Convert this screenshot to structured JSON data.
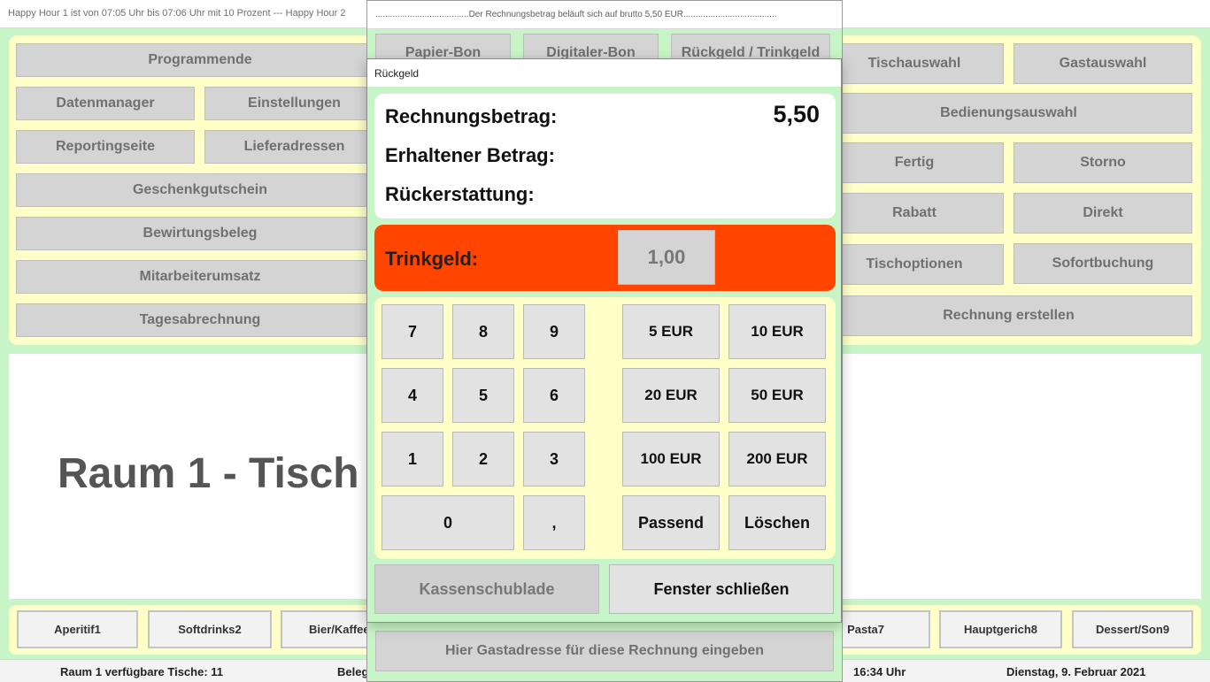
{
  "ticker": "Happy Hour 1 ist von 07:05 Uhr bis 07:06 Uhr mit 10 Prozent --- Happy Hour 2",
  "left_menu": {
    "programmende": "Programmende",
    "datenmanager": "Datenmanager",
    "einstellungen": "Einstellungen",
    "reportingseite": "Reportingseite",
    "lieferadressen": "Lieferadressen",
    "geschenkgutschein": "Geschenkgutschein",
    "bewirtungsbeleg": "Bewirtungsbeleg",
    "mitarbeiterumsatz": "Mitarbeiterumsatz",
    "tagesabrechnung": "Tagesabrechnung"
  },
  "right_menu": {
    "tischauswahl": "Tischauswahl",
    "gastauswahl": "Gastauswahl",
    "bedienungsauswahl": "Bedienungsauswahl",
    "fertig": "Fertig",
    "storno": "Storno",
    "rabatt": "Rabatt",
    "direkt": "Direkt",
    "tischoptionen": "Tischoptionen",
    "sofortbuchung": "Sofortbuchung",
    "rechnung_erstellen": "Rechnung erstellen"
  },
  "room_title": "Raum 1 - Tisch",
  "categories": [
    "Aperitif1",
    "Softdrinks2",
    "Bier/Kaffee",
    "Pasta7",
    "Hauptgerich8",
    "Dessert/Son9"
  ],
  "status": {
    "tables": "Raum 1 verfügbare Tische: 11",
    "beleg": "Beleg",
    "time": "16:34 Uhr",
    "date": "Dienstag, 9. Februar 2021"
  },
  "rechnung": {
    "title": "......................................Der Rechnungsbetrag beläuft sich auf brutto 5,50 EUR......................................",
    "papier_bon": "Papier-Bon",
    "digitaler_bon": "Digitaler-Bon",
    "rueckgeld_trinkgeld": "Rückgeld / Trinkgeld",
    "gastadresse": "Hier Gastadresse für diese Rechnung eingeben"
  },
  "dialog": {
    "title": "Rückgeld",
    "rechnungsbetrag_label": "Rechnungsbetrag:",
    "rechnungsbetrag_value": "5,50",
    "erhalten_label": "Erhaltener Betrag:",
    "rueckerstattung_label": "Rückerstattung:",
    "trinkgeld_label": "Trinkgeld:",
    "trinkgeld_value": "1,00",
    "keys": {
      "k7": "7",
      "k8": "8",
      "k9": "9",
      "k4": "4",
      "k5": "5",
      "k6": "6",
      "k1": "1",
      "k2": "2",
      "k3": "3",
      "k0": "0",
      "comma": ","
    },
    "amounts": {
      "eur5": "5 EUR",
      "eur10": "10 EUR",
      "eur20": "20 EUR",
      "eur50": "50 EUR",
      "eur100": "100 EUR",
      "eur200": "200 EUR"
    },
    "passend": "Passend",
    "loeschen": "Löschen",
    "kassenschublade": "Kassenschublade",
    "fenster_schliessen": "Fenster schließen"
  },
  "colors": {
    "green_bg": "#c8f5c8",
    "yellow_panel": "#ffffc8",
    "tip_orange": "#ff4500",
    "button_grey": "#d4d4d4"
  }
}
